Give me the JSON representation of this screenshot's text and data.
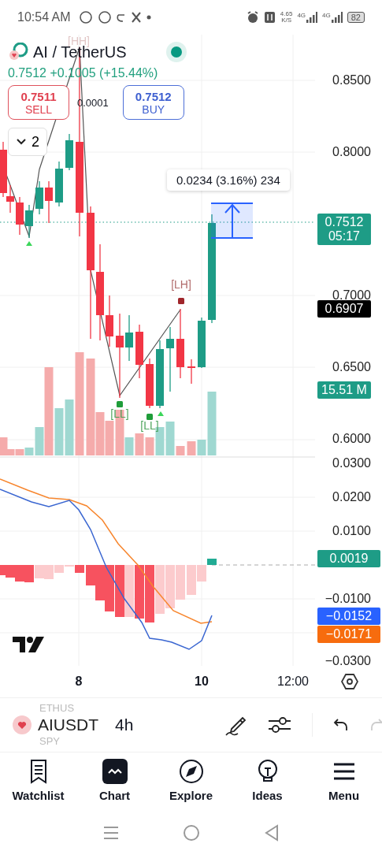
{
  "status_bar": {
    "time": "10:54 AM",
    "speed_value": "4.65",
    "speed_unit": "K/S",
    "signals": [
      "4G",
      "4G"
    ],
    "battery": "82"
  },
  "header": {
    "title": "AI / TetherUS",
    "market_open": true,
    "price_change": "0.7512 +0.1005 (+15.44%)",
    "sell": {
      "price": "0.7511",
      "label": "SELL"
    },
    "spread": "0.0001",
    "buy": {
      "price": "0.7512",
      "label": "BUY"
    },
    "indicators_count": "2"
  },
  "chart": {
    "pivot_labels": [
      {
        "text": "[HH]",
        "kind": "high",
        "faded": true
      },
      {
        "text": "[LH]",
        "kind": "high",
        "faded": false
      },
      {
        "text": "[LL]",
        "kind": "low",
        "faded": false
      },
      {
        "text": "[LL]",
        "kind": "low",
        "faded": false
      }
    ],
    "measure_tooltip": "0.0234 (3.16%) 234",
    "price_ticks": [
      "0.8500",
      "0.8000",
      "0.7000",
      "0.6500",
      "0.6000"
    ],
    "price_badges": [
      {
        "lines": [
          "0.7512",
          "05:17"
        ],
        "color": "#1e9c86"
      },
      {
        "lines": [
          "0.6907"
        ],
        "color": "#000000"
      },
      {
        "lines": [
          "15.51 M"
        ],
        "color": "#1e9c86"
      }
    ],
    "macd_ticks": [
      "0.0300",
      "0.0200",
      "0.0100",
      "−0.0100",
      "−0.0300"
    ],
    "macd_badges": [
      {
        "text": "0.0019",
        "color": "#1e9c86"
      },
      {
        "text": "−0.0152",
        "color": "#2962ff"
      },
      {
        "text": "−0.0171",
        "color": "#f76c0e"
      }
    ],
    "time_ticks": [
      "8",
      "10",
      "12:00"
    ]
  },
  "toolbar": {
    "symbols": [
      {
        "text": "ETHUS",
        "selected": false
      },
      {
        "text": "AIUSDT",
        "selected": true
      },
      {
        "text": "SPY",
        "selected": false
      }
    ],
    "interval": "4h",
    "redo_disabled": true
  },
  "nav": [
    {
      "label": "Watchlist",
      "selected": false
    },
    {
      "label": "Chart",
      "selected": true
    },
    {
      "label": "Explore",
      "selected": false
    },
    {
      "label": "Ideas",
      "selected": false
    },
    {
      "label": "Menu",
      "selected": false
    }
  ]
}
